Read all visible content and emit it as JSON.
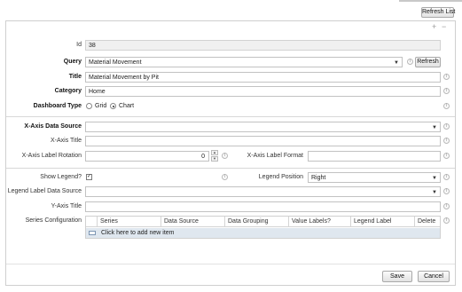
{
  "toolbar": {
    "refresh_list_label": "Refresh List"
  },
  "panel_controls": {
    "plus": "+",
    "minus": "−"
  },
  "form": {
    "id": {
      "label": "Id",
      "value": "38"
    },
    "query": {
      "label": "Query",
      "value": "Material Movement",
      "refresh_label": "Refresh"
    },
    "title": {
      "label": "Title",
      "value": "Material Movement by Pit"
    },
    "category": {
      "label": "Category",
      "value": "Home"
    },
    "dashboard_type": {
      "label": "Dashboard Type",
      "options": [
        "Grid",
        "Chart"
      ],
      "selected": "Chart"
    },
    "x_axis_data_source": {
      "label": "X-Axis Data Source",
      "value": ""
    },
    "x_axis_title": {
      "label": "X-Axis Title",
      "value": ""
    },
    "x_axis_label_rotation": {
      "label": "X-Axis Label Rotation",
      "value": "0"
    },
    "x_axis_label_format": {
      "label": "X-Axis Label Format",
      "value": ""
    },
    "show_legend": {
      "label": "Show Legend?",
      "checked": true,
      "check_glyph": "✓"
    },
    "legend_position": {
      "label": "Legend Position",
      "value": "Right"
    },
    "legend_label_data_source": {
      "label": "Legend Label Data Source",
      "value": ""
    },
    "y_axis_title": {
      "label": "Y-Axis Title",
      "value": ""
    },
    "series_configuration": {
      "label": "Series Configuration",
      "columns": [
        "Series",
        "Data Source",
        "Data Grouping",
        "Value Labels?",
        "Legend Label",
        "Delete"
      ],
      "add_item_text": "Click here to add new item"
    }
  },
  "footer": {
    "save_label": "Save",
    "cancel_label": "Cancel"
  },
  "icons": {
    "info": "i",
    "dropdown": "▼",
    "spin_up": "▲",
    "spin_down": "▼"
  }
}
